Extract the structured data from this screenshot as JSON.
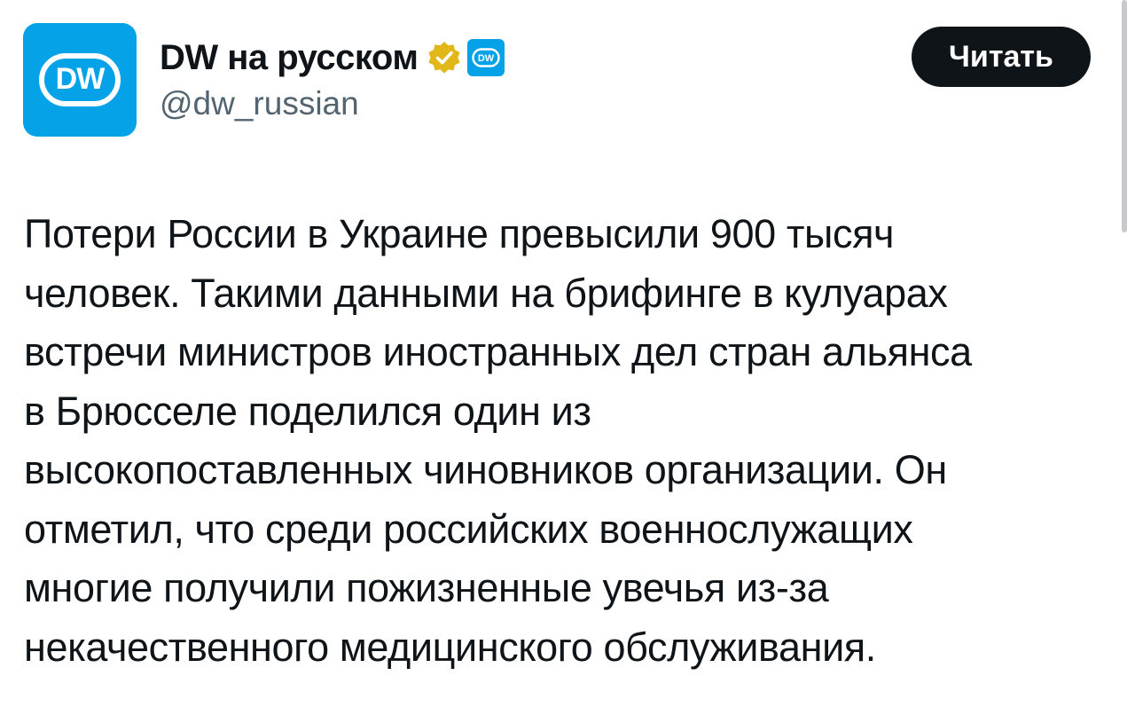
{
  "account": {
    "display_name": "DW на русском",
    "handle": "@dw_russian",
    "avatar_label": "DW",
    "verified_icon": "verified-badge-gold",
    "affiliate_icon": "dw-logo-badge",
    "brand_color": "#05a2e8",
    "verified_color": "#e2b719"
  },
  "actions": {
    "read_label": "Читать"
  },
  "tweet": {
    "lines": [
      "Потери России в Украине превысили 900 тысяч",
      "человек. Такими данными на брифинге в кулуарах",
      "встречи министров иностранных дел стран альянса",
      "в Брюсселе поделился один из",
      "высокопоставленных чиновников организации. Он",
      "отметил, что среди российских военнослужащих",
      "многие получили пожизненные увечья из-за",
      "некачественного медицинского обслуживания."
    ]
  }
}
